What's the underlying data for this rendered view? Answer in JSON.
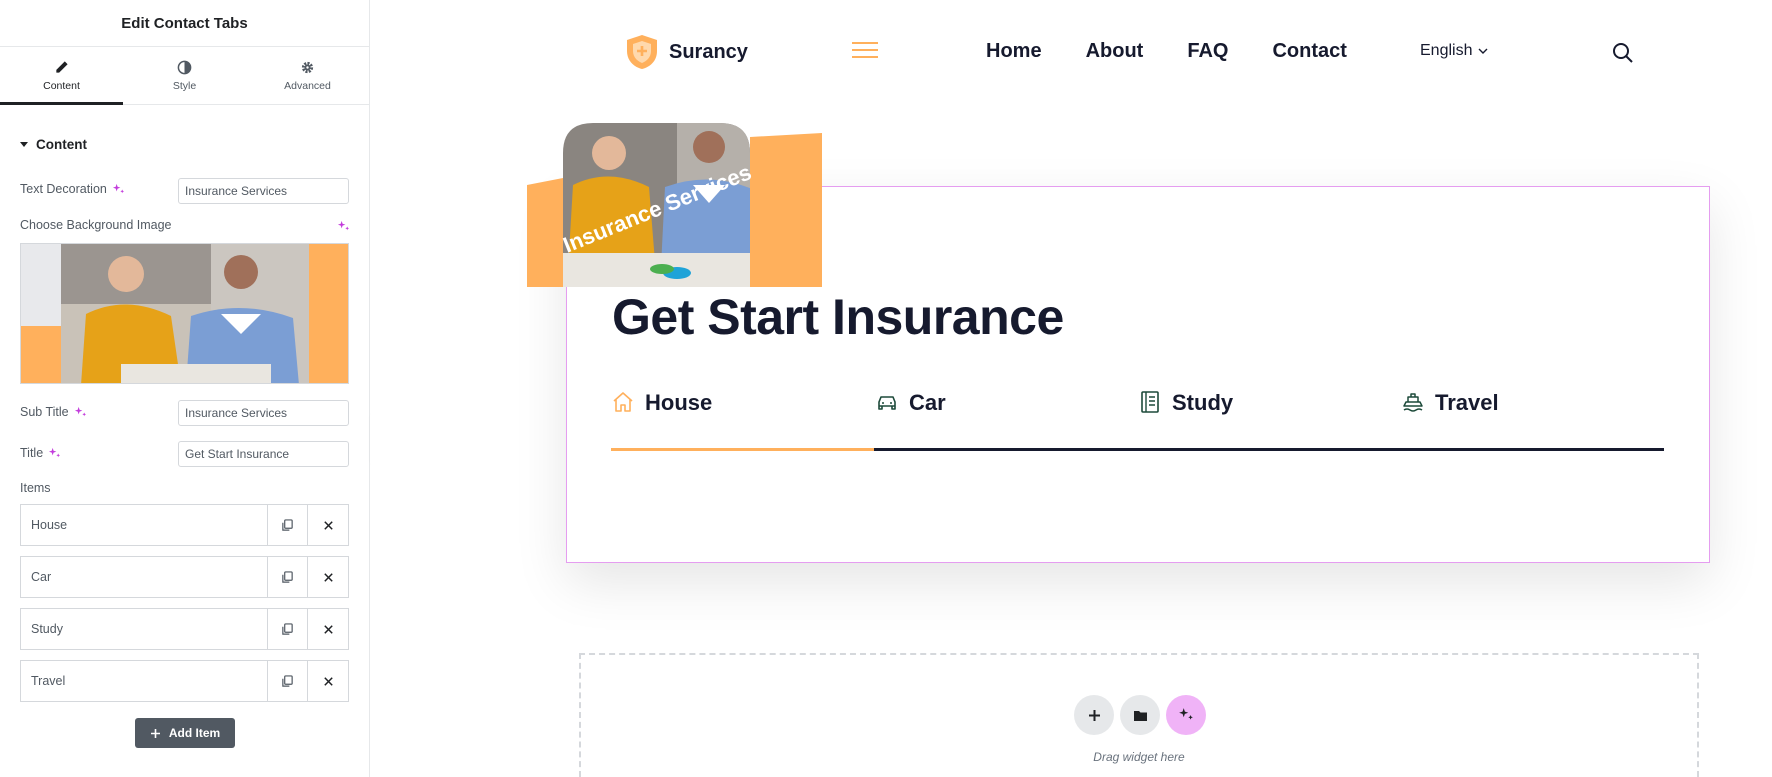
{
  "panel": {
    "title": "Edit Contact Tabs",
    "tabs": [
      {
        "label": "Content",
        "icon": "pencil-icon"
      },
      {
        "label": "Style",
        "icon": "contrast-icon"
      },
      {
        "label": "Advanced",
        "icon": "gear-icon"
      }
    ],
    "active_tab": "Content",
    "section_title": "Content",
    "controls": {
      "text_decoration": {
        "label": "Text Decoration",
        "value": "Insurance Services"
      },
      "background_image": {
        "label": "Choose Background Image"
      },
      "sub_title": {
        "label": "Sub Title",
        "value": "Insurance Services"
      },
      "title": {
        "label": "Title",
        "value": "Get Start Insurance"
      }
    },
    "items_label": "Items",
    "items": [
      "House",
      "Car",
      "Study",
      "Travel"
    ],
    "add_item_label": "Add Item"
  },
  "site": {
    "logo_text": "Surancy",
    "nav": [
      "Home",
      "About",
      "FAQ",
      "Contact"
    ],
    "language": "English",
    "image_badge_text": "Insurance Services",
    "hero_title": "Get Start Insurance",
    "tabs": [
      {
        "label": "House",
        "icon": "house-icon"
      },
      {
        "label": "Car",
        "icon": "car-icon"
      },
      {
        "label": "Study",
        "icon": "book-icon"
      },
      {
        "label": "Travel",
        "icon": "ship-icon"
      }
    ],
    "active_tab": "House",
    "drop_zone_text": "Drag widget here"
  },
  "colors": {
    "accent": "#ffb05c",
    "dark": "#161a2e",
    "editor_highlight": "#e59df0",
    "ai_pink": "#c33ddc"
  }
}
